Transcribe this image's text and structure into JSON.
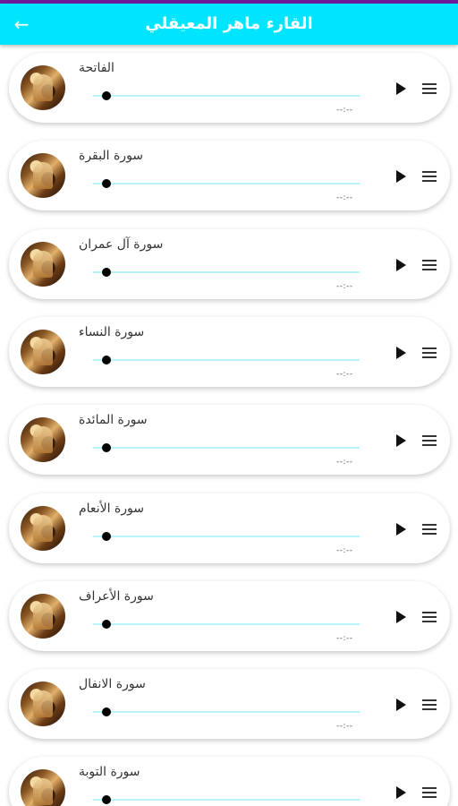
{
  "header": {
    "title": "القارء ماهر المعيقلي",
    "back_icon": "arrow-back-icon"
  },
  "colors": {
    "appbar": "#00e5ff",
    "statusbar": "#6a1b9a",
    "track": "#b9f3fb"
  },
  "surahs": [
    {
      "name": "الفاتحة",
      "time": "--:--",
      "progress": 0
    },
    {
      "name": "سورة البقرة",
      "time": "--:--",
      "progress": 0
    },
    {
      "name": "سورة آل عمران",
      "time": "--:--",
      "progress": 0
    },
    {
      "name": "سورة النساء",
      "time": "--:--",
      "progress": 0
    },
    {
      "name": "سورة المائدة",
      "time": "--:--",
      "progress": 0
    },
    {
      "name": "سورة الأنعام",
      "time": "--:--",
      "progress": 0
    },
    {
      "name": "سورة الأعراف",
      "time": "--:--",
      "progress": 0
    },
    {
      "name": "سورة الانفال",
      "time": "--:--",
      "progress": 0
    },
    {
      "name": "سورة التوبة",
      "time": "--:--",
      "progress": 0
    }
  ]
}
